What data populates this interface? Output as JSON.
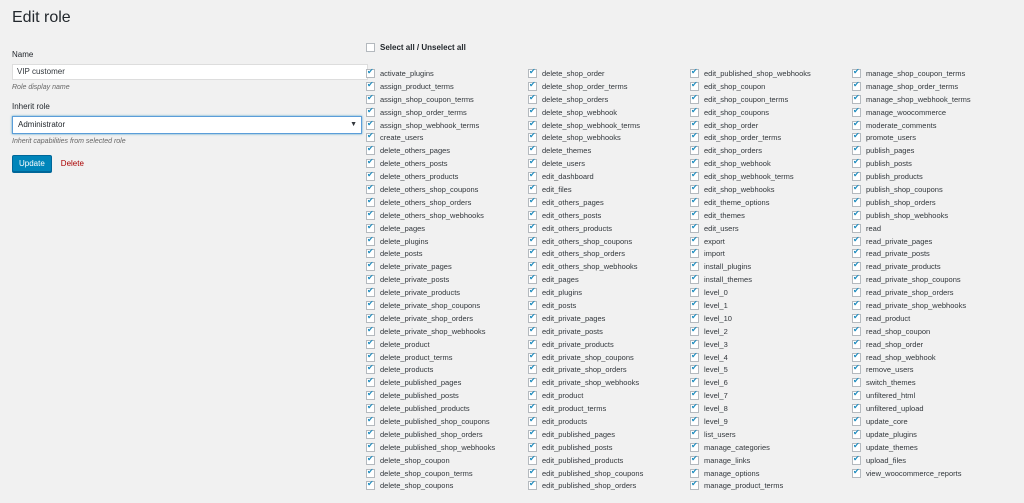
{
  "page": {
    "title": "Edit role"
  },
  "form": {
    "name_label": "Name",
    "name_value": "VIP customer",
    "name_desc": "Role display name",
    "inherit_label": "Inherit role",
    "inherit_value": "Administrator",
    "inherit_desc": "Inherit capabilities from selected role",
    "update_label": "Update",
    "delete_label": "Delete"
  },
  "capabilities": {
    "select_all_label": "Select all / Unselect all",
    "columns": [
      [
        "activate_plugins",
        "assign_product_terms",
        "assign_shop_coupon_terms",
        "assign_shop_order_terms",
        "assign_shop_webhook_terms",
        "create_users",
        "delete_others_pages",
        "delete_others_posts",
        "delete_others_products",
        "delete_others_shop_coupons",
        "delete_others_shop_orders",
        "delete_others_shop_webhooks",
        "delete_pages",
        "delete_plugins",
        "delete_posts",
        "delete_private_pages",
        "delete_private_posts",
        "delete_private_products",
        "delete_private_shop_coupons",
        "delete_private_shop_orders",
        "delete_private_shop_webhooks",
        "delete_product",
        "delete_product_terms",
        "delete_products",
        "delete_published_pages",
        "delete_published_posts",
        "delete_published_products",
        "delete_published_shop_coupons",
        "delete_published_shop_orders",
        "delete_published_shop_webhooks",
        "delete_shop_coupon",
        "delete_shop_coupon_terms",
        "delete_shop_coupons"
      ],
      [
        "delete_shop_order",
        "delete_shop_order_terms",
        "delete_shop_orders",
        "delete_shop_webhook",
        "delete_shop_webhook_terms",
        "delete_shop_webhooks",
        "delete_themes",
        "delete_users",
        "edit_dashboard",
        "edit_files",
        "edit_others_pages",
        "edit_others_posts",
        "edit_others_products",
        "edit_others_shop_coupons",
        "edit_others_shop_orders",
        "edit_others_shop_webhooks",
        "edit_pages",
        "edit_plugins",
        "edit_posts",
        "edit_private_pages",
        "edit_private_posts",
        "edit_private_products",
        "edit_private_shop_coupons",
        "edit_private_shop_orders",
        "edit_private_shop_webhooks",
        "edit_product",
        "edit_product_terms",
        "edit_products",
        "edit_published_pages",
        "edit_published_posts",
        "edit_published_products",
        "edit_published_shop_coupons",
        "edit_published_shop_orders"
      ],
      [
        "edit_published_shop_webhooks",
        "edit_shop_coupon",
        "edit_shop_coupon_terms",
        "edit_shop_coupons",
        "edit_shop_order",
        "edit_shop_order_terms",
        "edit_shop_orders",
        "edit_shop_webhook",
        "edit_shop_webhook_terms",
        "edit_shop_webhooks",
        "edit_theme_options",
        "edit_themes",
        "edit_users",
        "export",
        "import",
        "install_plugins",
        "install_themes",
        "level_0",
        "level_1",
        "level_10",
        "level_2",
        "level_3",
        "level_4",
        "level_5",
        "level_6",
        "level_7",
        "level_8",
        "level_9",
        "list_users",
        "manage_categories",
        "manage_links",
        "manage_options",
        "manage_product_terms"
      ],
      [
        "manage_shop_coupon_terms",
        "manage_shop_order_terms",
        "manage_shop_webhook_terms",
        "manage_woocommerce",
        "moderate_comments",
        "promote_users",
        "publish_pages",
        "publish_posts",
        "publish_products",
        "publish_shop_coupons",
        "publish_shop_orders",
        "publish_shop_webhooks",
        "read",
        "read_private_pages",
        "read_private_posts",
        "read_private_products",
        "read_private_shop_coupons",
        "read_private_shop_orders",
        "read_private_shop_webhooks",
        "read_product",
        "read_shop_coupon",
        "read_shop_order",
        "read_shop_webhook",
        "remove_users",
        "switch_themes",
        "unfiltered_html",
        "unfiltered_upload",
        "update_core",
        "update_plugins",
        "update_themes",
        "upload_files",
        "view_woocommerce_reports"
      ]
    ]
  },
  "colors": {
    "primary": "#0085ba",
    "delete": "#aa0000",
    "check": "#1e8cbe",
    "background": "#f1f1f1"
  }
}
